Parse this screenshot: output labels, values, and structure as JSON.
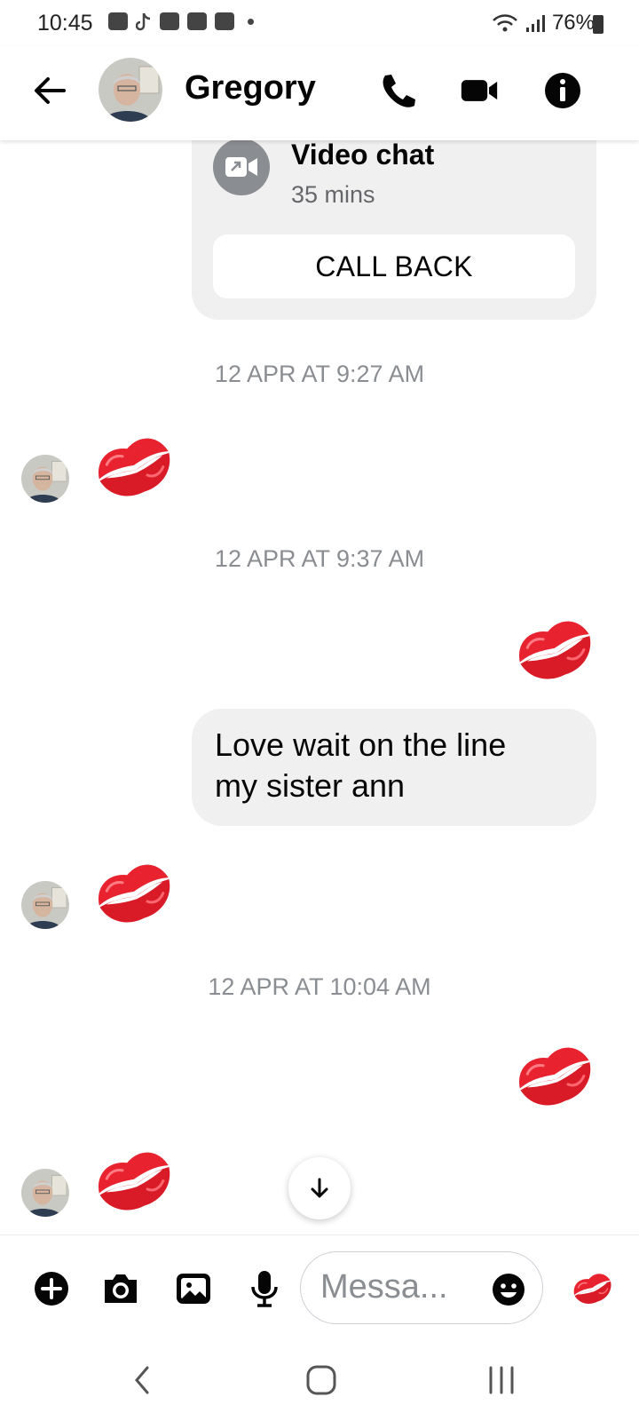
{
  "status_bar": {
    "time": "10:45",
    "battery": "76%",
    "notification_icons": [
      "shop-icon",
      "tiktok-icon",
      "folder-icon",
      "youtube-icon",
      "youtube-icon"
    ]
  },
  "header": {
    "contact_name": "Gregory"
  },
  "call_card": {
    "title": "Video chat",
    "duration": "35 mins",
    "button_label": "CALL BACK"
  },
  "timestamps": {
    "t1": "12 APR AT 9:27 AM",
    "t2": "12 APR AT 9:37 AM",
    "t3": "12 APR AT 10:04 AM"
  },
  "messages": [
    {
      "from": "them",
      "type": "kiss-emoji"
    },
    {
      "from": "me",
      "type": "kiss-emoji"
    },
    {
      "from": "me",
      "type": "text",
      "text_line1": "Love wait on the line",
      "text_line2": "my sister ann"
    },
    {
      "from": "them",
      "type": "kiss-emoji"
    },
    {
      "from": "me",
      "type": "kiss-emoji"
    },
    {
      "from": "them",
      "type": "kiss-emoji"
    }
  ],
  "composer": {
    "placeholder": "Messa..."
  },
  "colors": {
    "kiss_red": "#e8232f",
    "bubble_grey": "#f0f0f0",
    "muted_text": "#8a8d91"
  }
}
